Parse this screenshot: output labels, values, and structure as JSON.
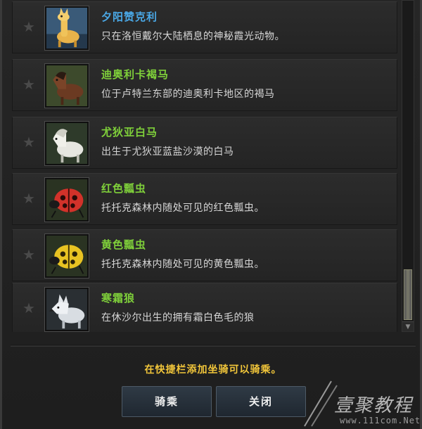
{
  "mounts": [
    {
      "name": "夕阳赞克利",
      "description": "只在洛恒戴尔大陆栖息的神秘霞光动物。",
      "name_color": "#4aa8e6",
      "icon": "llama-icon"
    },
    {
      "name": "迪奥利卡褐马",
      "description": "位于卢特兰东部的迪奥利卡地区的褐马",
      "name_color": "#7fd03a",
      "icon": "brown-horse-icon"
    },
    {
      "name": "尤狄亚白马",
      "description": "出生于尤狄亚蓝盐沙漠的白马",
      "name_color": "#7fd03a",
      "icon": "white-horse-icon"
    },
    {
      "name": "红色瓢虫",
      "description": "托托克森林内随处可见的红色瓢虫。",
      "name_color": "#7fd03a",
      "icon": "red-ladybug-icon"
    },
    {
      "name": "黄色瓢虫",
      "description": "托托克森林内随处可见的黄色瓢虫。",
      "name_color": "#7fd03a",
      "icon": "yellow-ladybug-icon"
    },
    {
      "name": "寒霜狼",
      "description": "在休沙尔出生的拥有霜白色毛的狼",
      "name_color": "#7fd03a",
      "icon": "frost-wolf-icon"
    }
  ],
  "hint": "在快捷栏添加坐骑可以骑乘。",
  "buttons": {
    "ride": "骑乘",
    "close": "关闭"
  },
  "watermark": {
    "text": "壹聚教程",
    "url": "www.111com.Net"
  }
}
